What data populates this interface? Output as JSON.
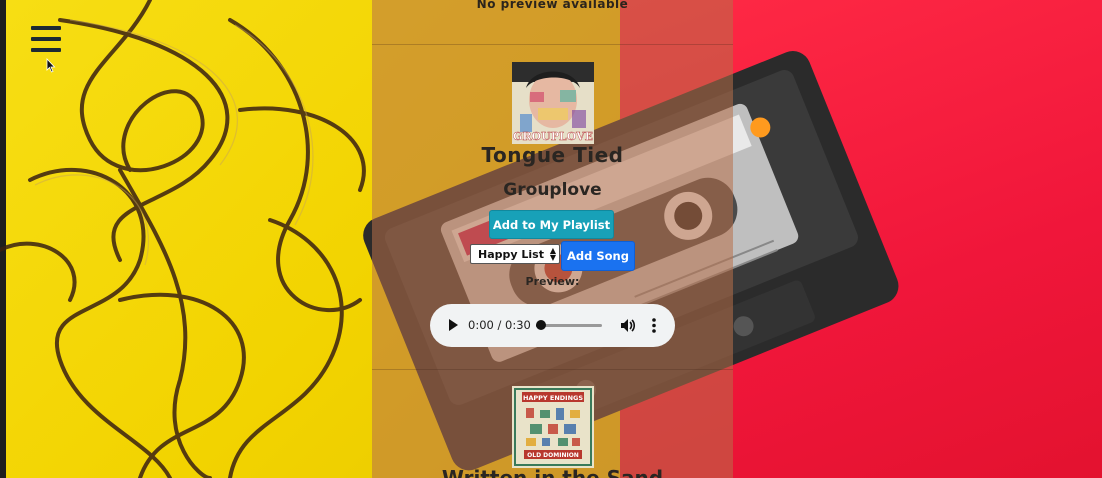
{
  "nav": {
    "menu_icon": "hamburger-menu-icon"
  },
  "previous_song": {
    "no_preview_text": "No preview available"
  },
  "current_song": {
    "title": "Tongue Tied",
    "artist": "Grouplove",
    "cover_logo_text": "GROUPLOVE",
    "add_to_playlist_label": "Add to My Playlist",
    "playlist_select": {
      "selected": "Happy List"
    },
    "add_song_label": "Add Song",
    "preview_label": "Preview:",
    "audio": {
      "time": "0:00 / 0:30",
      "progress": 0.0
    }
  },
  "next_song": {
    "cover_text_top": "HAPPY ENDINGS",
    "cover_text_bottom": "OLD DOMINION",
    "title_partial": "Written in the Sand"
  },
  "colors": {
    "overlay": "#b87048",
    "add_to_playlist_bg": "#18a1b8",
    "add_song_bg": "#1a72f0",
    "bg_left": "#f2d300",
    "bg_right": "#f0163a"
  }
}
